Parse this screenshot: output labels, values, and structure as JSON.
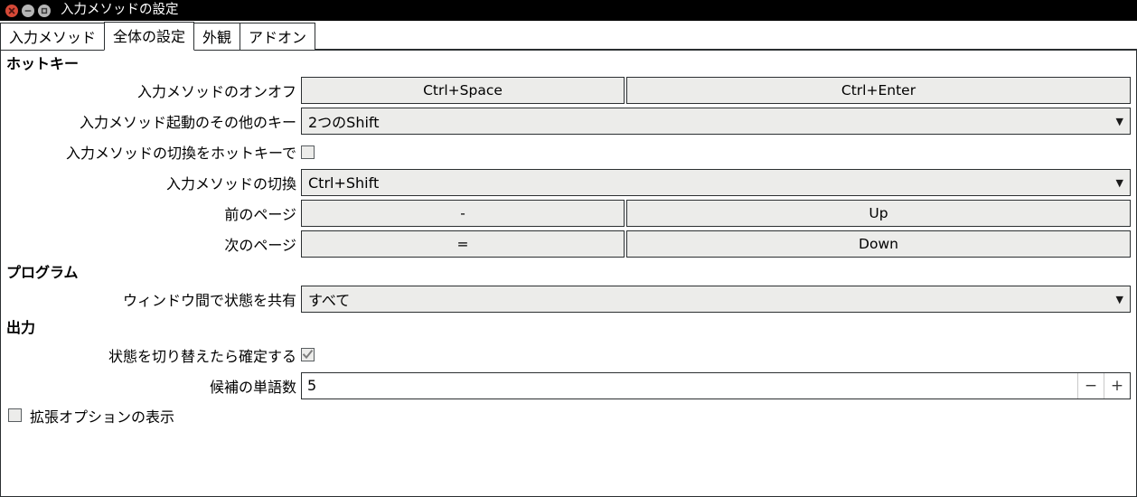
{
  "window": {
    "title": "入力メソッドの設定",
    "controls": [
      {
        "name": "close",
        "glyph": "×"
      },
      {
        "name": "minimize",
        "glyph": "−"
      },
      {
        "name": "maximize",
        "glyph": "□"
      }
    ]
  },
  "tabs": [
    {
      "label": "入力メソッド",
      "active": false
    },
    {
      "label": "全体の設定",
      "active": true
    },
    {
      "label": "外観",
      "active": false
    },
    {
      "label": "アドオン",
      "active": false
    }
  ],
  "sections": {
    "hotkey": {
      "header": "ホットキー",
      "toggle_label": "入力メソッドのオンオフ",
      "toggle_key1": "Ctrl+Space",
      "toggle_key2": "Ctrl+Enter",
      "alt_trigger_label": "入力メソッド起動のその他のキー",
      "alt_trigger_value": "2つのShift",
      "switch_by_hotkey_label": "入力メソッドの切換をホットキーで",
      "switch_by_hotkey_checked": false,
      "switch_label": "入力メソッドの切換",
      "switch_value": "Ctrl+Shift",
      "prev_page_label": "前のページ",
      "prev_page_key1": "-",
      "prev_page_key2": "Up",
      "next_page_label": "次のページ",
      "next_page_key1": "=",
      "next_page_key2": "Down"
    },
    "program": {
      "header": "プログラム",
      "share_state_label": "ウィンドウ間で状態を共有",
      "share_state_value": "すべて"
    },
    "output": {
      "header": "出力",
      "commit_label": "状態を切り替えたら確定する",
      "commit_checked": true,
      "candidate_count_label": "候補の単語数",
      "candidate_count_value": "5",
      "spin_minus": "−",
      "spin_plus": "+"
    }
  },
  "footer": {
    "advanced_label": "拡張オプションの表示",
    "advanced_checked": false
  },
  "icons": {
    "combo_arrow": "▼"
  }
}
